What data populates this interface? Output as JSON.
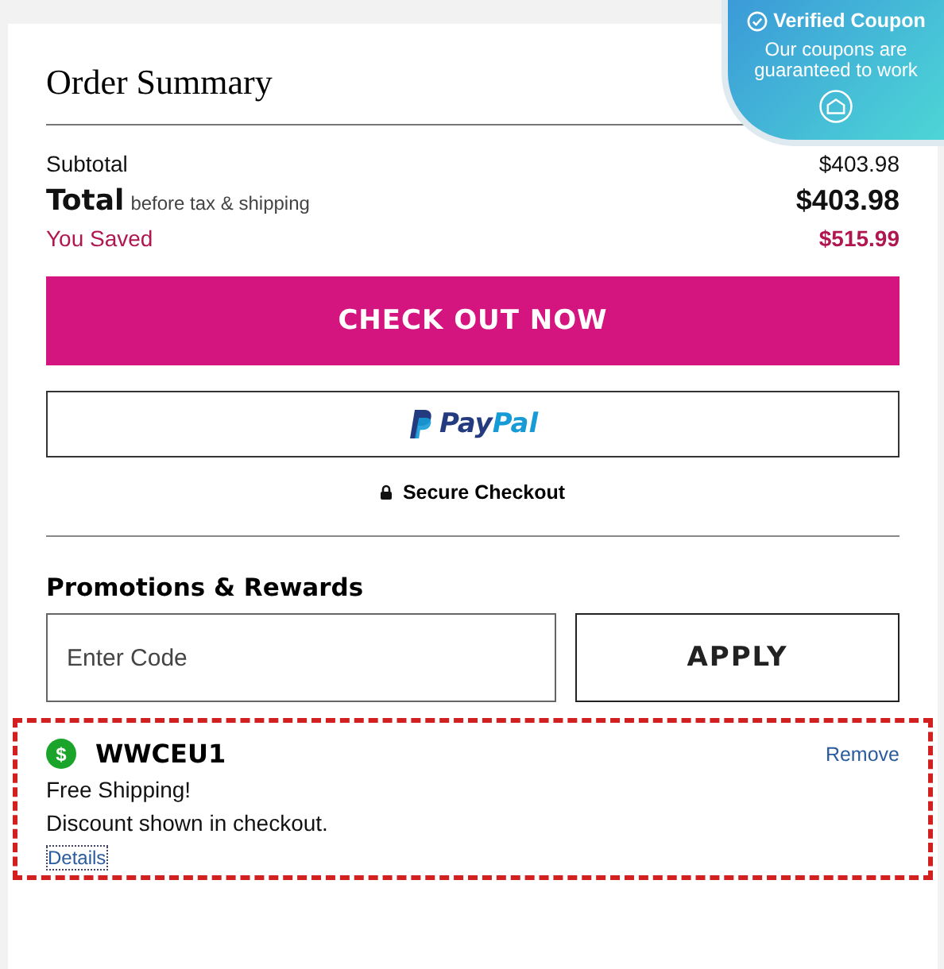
{
  "badge": {
    "title": "Verified Coupon",
    "text": "Our coupons are guaranteed to work"
  },
  "summary": {
    "title": "Order Summary",
    "rows": [
      {
        "kind": "subtotal",
        "label": "Subtotal",
        "value": "$403.98"
      },
      {
        "kind": "total",
        "label": "Total",
        "note": "before tax & shipping",
        "value": "$403.98"
      },
      {
        "kind": "saved",
        "label": "You Saved",
        "value": "$515.99"
      }
    ]
  },
  "checkout_button": "CHECK OUT NOW",
  "paypal_button": {
    "parts": [
      "Pay",
      "Pal"
    ]
  },
  "secure_note": "Secure Checkout",
  "promotions": {
    "title": "Promotions & Rewards",
    "placeholder": "Enter Code",
    "apply_button": "APPLY"
  },
  "coupon": {
    "icon": "$",
    "code": "WWCEU1",
    "remove": "Remove",
    "lines": [
      "Free Shipping!",
      "Discount shown in checkout."
    ],
    "details": "Details"
  }
}
